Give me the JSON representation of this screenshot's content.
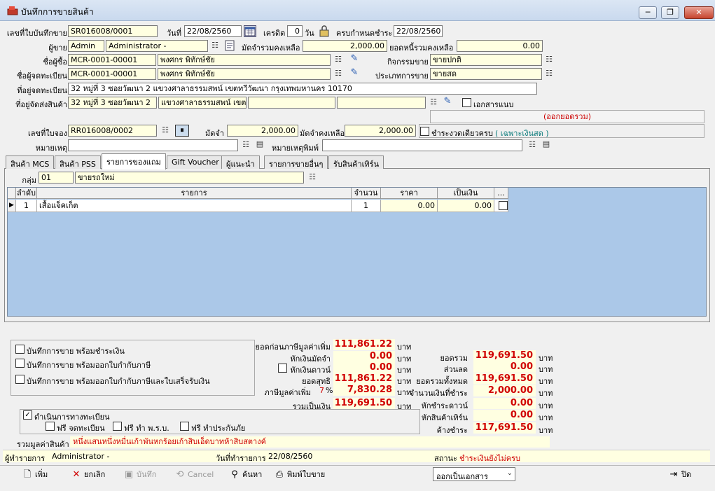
{
  "window": {
    "title": "บันทึกการขายสินค้า",
    "minimize_glyph": "─",
    "maximize_glyph": "❐",
    "close_glyph": "✕"
  },
  "header": {
    "doc_no_label": "เลขที่ใบบันทึกขาย",
    "doc_no": "SR016008/0001",
    "date_label": "วันที่",
    "date": "22/08/2560",
    "credit_label": "เครดิต",
    "credit_days": "0",
    "credit_unit": "วัน",
    "due_label": "ครบกำหนดชำระ",
    "due_date": "22/08/2560",
    "seller_label": "ผู้ขาย",
    "seller_code": "Admin",
    "seller_name": "Administrator -",
    "deposit_left_label": "มัดจำรวมคงเหลือ",
    "deposit_left": "2,000.00",
    "debt_left_label": "ยอดหนี้รวมคงเหลือ",
    "debt_left": "0.00",
    "buyer_label": "ชื่อผู้ซื้อ",
    "buyer_code": "MCR-0001-00001",
    "buyer_name": "พงศกร พิทักษ์ชัย",
    "activity_label": "กิจกรรมขาย",
    "activity": "ขายปกติ",
    "registrant_label": "ชื่อผู้จดทะเบียน",
    "registrant_code": "MCR-0001-00001",
    "registrant_name": "พงศกร พิทักษ์ชัย",
    "sale_type_label": "ประเภทการขาย",
    "sale_type": "ขายสด",
    "reg_address_label": "ที่อยู่จดทะเบียน",
    "reg_address": "32 หมู่ที่ 3 ซอยวัฒนา 2 แขวงศาลาธรรมสพน์ เขตทวีวัฒนา กรุงเทพมหานคร 10170",
    "ship_address_label": "ที่อยู่จัดส่งสินค้า",
    "ship_address_1": "32 หมู่ที่ 3 ซอยวัฒนา 2",
    "ship_address_2": "แขวงศาลาธรรมสพน์ เขต",
    "attach_label": "เอกสารแนบ",
    "combine_label": "(ออกยอดรวม)",
    "booking_label": "เลขที่ใบจอง",
    "booking_no": "RR016008/0002",
    "deposit_label": "มัดจำ",
    "deposit": "2,000.00",
    "deposit_remain_label": "มัดจำคงเหลือ",
    "deposit_remain": "2,000.00",
    "pay_once_label": "ชำระงวดเดียวครบ",
    "cash_only_label": "( เฉพาะเงินสด )",
    "remark_label": "หมายเหตุ",
    "print_remark_label": "หมายเหตุพิมพ์"
  },
  "tabs": [
    "สินค้า MCS",
    "สินค้า PSS",
    "รายการของแถม",
    "Gift Voucher",
    "ผู้แนะนำ",
    "รายการขายอื่นๆ",
    "รับสินค้าเทิร์น"
  ],
  "group": {
    "label": "กลุ่ม",
    "code": "01",
    "name": "ขายรถใหม่"
  },
  "grid": {
    "columns": {
      "seq": "ลำดับ",
      "item": "รายการ",
      "qty": "จำนวน",
      "price": "ราคา",
      "amount": "เป็นเงิน",
      "more": "..."
    },
    "rows": [
      {
        "seq": "1",
        "item": "เสื้อแจ็คเก็ต",
        "qty": "1",
        "price": "0.00",
        "amount": "0.00"
      }
    ]
  },
  "options": {
    "save_pay": "บันทึกการขาย พร้อมชำระเงิน",
    "save_tax": "บันทึกการขาย พร้อมออกใบกำกับภาษี",
    "save_tax_receipt": "บันทึกการขาย พร้อมออกใบกำกับภาษีและใบเสร็จรับเงิน",
    "registration": "ดำเนินการทางทะเบียน",
    "free_reg": "ฟรี จดทะเบียน",
    "free_act": "ฟรี ทำ พ.ร.บ.",
    "free_ins": "ฟรี ทำประกันภัย"
  },
  "summary": {
    "baht": "บาท",
    "pre_vat_label": "ยอดก่อนภาษีมูลค่าเพิ่ม",
    "pre_vat": "111,861.22",
    "minus_deposit_label": "หักเงินมัดจำ",
    "minus_deposit": "0.00",
    "minus_down_label": "หักเงินดาวน์",
    "minus_down": "0.00",
    "net_label": "ยอดสุทธิ",
    "net": "111,861.22",
    "vat_label": "ภาษีมูลค่าเพิ่ม",
    "vat_rate": "7",
    "vat_pct": "%",
    "vat": "7,830.28",
    "total_label": "รวมเป็นเงิน",
    "total": "119,691.50",
    "gross_label": "ยอดรวม",
    "gross": "119,691.50",
    "discount_label": "ส่วนลด",
    "discount": "0.00",
    "grand_label": "ยอดรวมทั้งหมด",
    "grand": "119,691.50",
    "paid_label": "จำนวนเงินที่ชำระ",
    "paid": "2,000.00",
    "down_paid_label": "หักชำระดาวน์",
    "down_paid": "0.00",
    "turn_label": "หักสินค้าเทิร์น",
    "turn": "0.00",
    "outstanding_label": "ค้างชำระ",
    "outstanding": "117,691.50",
    "in_words_label": "รวมมูลค่าสินค้า",
    "in_words": "หนึ่งแสนหนึ่งหมื่นเก้าพันหกร้อยเก้าสิบเอ็ดบาทห้าสิบสตางค์"
  },
  "footer": {
    "maker_label": "ผู้ทำรายการ",
    "maker": "Administrator -",
    "made_date_label": "วันที่ทำรายการ",
    "made_date": "22/08/2560",
    "status_label": "สถานะ",
    "status": "ชำระเงินยังไม่ครบ"
  },
  "toolbar": {
    "add": "เพิ่ม",
    "cancel_doc": "ยกเลิก",
    "save": "บันทึก",
    "cancel": "Cancel",
    "search": "ค้นหา",
    "print": "พิมพ์ใบขาย",
    "export": "ออกเป็นเอกสาร",
    "close": "ปิด"
  },
  "colors": {
    "field_bg": "#ffffe1",
    "grid_bg": "#abc8e8",
    "value_red": "#d00000"
  }
}
